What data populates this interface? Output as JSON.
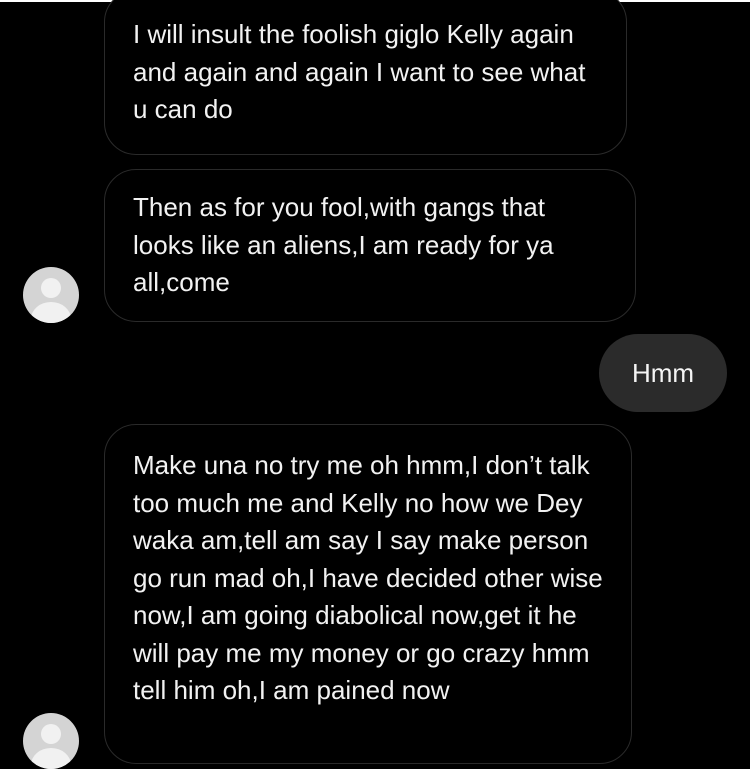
{
  "conversation": {
    "messages": [
      {
        "sender": "received",
        "text": "I will insult the foolish giglo Kelly again and again and again I want to see what u can do"
      },
      {
        "sender": "received",
        "text": "Then as for you fool,with gangs that looks like an aliens,I am ready for ya all,come"
      },
      {
        "sender": "sent",
        "text": "Hmm"
      },
      {
        "sender": "received",
        "text": "Make una no try me oh hmm,I don’t talk too much me and Kelly no how we Dey waka am,tell am say I say make person go run mad oh,I have decided other wise now,I am going diabolical now,get it he will pay me my money or go crazy hmm tell him oh,I am pained now"
      }
    ]
  },
  "icons": {
    "avatar": "user-avatar-icon"
  },
  "colors": {
    "background": "#000000",
    "received_bubble_border": "#2a2a2a",
    "sent_bubble": "#2b2b2b",
    "text": "#f2f2f2",
    "avatar": "#d4d4d4"
  }
}
